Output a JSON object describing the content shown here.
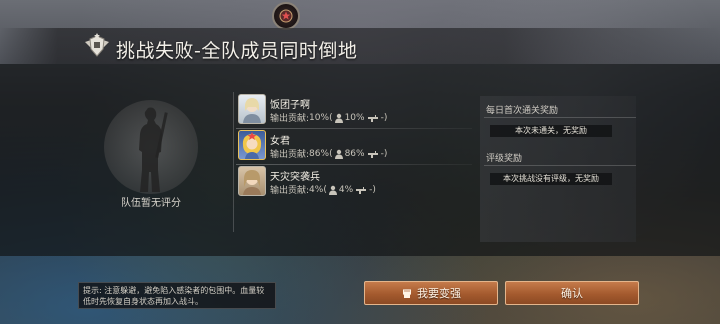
{
  "header": {
    "title": "挑战失败-全队成员同时倒地",
    "medal_icon": "star-medal-icon",
    "emblem_icon": "winged-shield-emblem-icon"
  },
  "rating": {
    "label": "队伍暂无评分",
    "icon": "soldier-silhouette-icon"
  },
  "members": [
    {
      "name": "饭团子啊",
      "contribution_label": "输出贡献:",
      "contribution": "10%",
      "stat_open": "(",
      "kill_share": "10%",
      "weapon_value": "-)",
      "avatar_color": "#c9d3dc"
    },
    {
      "name": "女君",
      "contribution_label": "输出贡献:",
      "contribution": "86%",
      "stat_open": "(",
      "kill_share": "86%",
      "weapon_value": "-)",
      "avatar_color": "#e8b84a"
    },
    {
      "name": "天灾突袭兵",
      "contribution_label": "输出贡献:",
      "contribution": "4%",
      "stat_open": "(",
      "kill_share": "4%",
      "weapon_value": "-)",
      "avatar_color": "#d9c7b0"
    }
  ],
  "rewards": {
    "daily_title": "每日首次通关奖励",
    "daily_value": "本次未通关，无奖励",
    "rating_title": "评级奖励",
    "rating_value": "本次挑战没有评级，无奖励"
  },
  "tip": {
    "text": "提示: 注意躲避，避免陷入感染者的包围中。血量较低时先恢复自身状态再加入战斗。"
  },
  "buttons": {
    "stronger_label": "我要变强",
    "stronger_icon": "fist-icon",
    "confirm_label": "确认"
  },
  "colors": {
    "button_primary": "#a45a2e",
    "button_border": "#e4b58c",
    "panel_bg": "#161718"
  }
}
